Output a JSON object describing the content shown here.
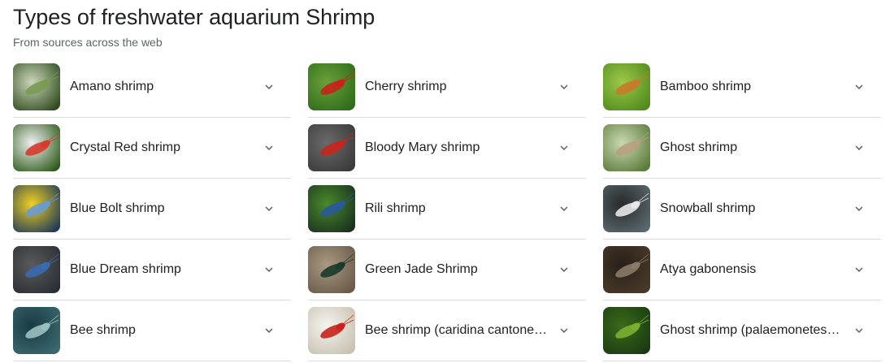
{
  "header": {
    "title": "Types of freshwater aquarium Shrimp",
    "subtitle": "From sources across the web"
  },
  "items": [
    {
      "label": "Amano shrimp",
      "icon": "chevron-down-icon",
      "thumb_colors": [
        "#2f4a1e",
        "#7a9a52",
        "#c9d6b8"
      ]
    },
    {
      "label": "Cherry shrimp",
      "icon": "chevron-down-icon",
      "thumb_colors": [
        "#2e6b1a",
        "#c8221a",
        "#6aa03a"
      ]
    },
    {
      "label": "Bamboo shrimp",
      "icon": "chevron-down-icon",
      "thumb_colors": [
        "#4f8a1c",
        "#c97a2a",
        "#9cc84a"
      ]
    },
    {
      "label": "Crystal Red shrimp",
      "icon": "chevron-down-icon",
      "thumb_colors": [
        "#2d5a1a",
        "#d63a2a",
        "#f0f0f0"
      ]
    },
    {
      "label": "Bloody Mary shrimp",
      "icon": "chevron-down-icon",
      "thumb_colors": [
        "#3a3a3a",
        "#c8261c",
        "#6a6a6a"
      ]
    },
    {
      "label": "Ghost shrimp",
      "icon": "chevron-down-icon",
      "thumb_colors": [
        "#5a7a3a",
        "#b8a080",
        "#c9d8b0"
      ]
    },
    {
      "label": "Blue Bolt shrimp",
      "icon": "chevron-down-icon",
      "thumb_colors": [
        "#1e3a5a",
        "#6a9ad0",
        "#f0d020"
      ]
    },
    {
      "label": "Rili shrimp",
      "icon": "chevron-down-icon",
      "thumb_colors": [
        "#1a3020",
        "#2a5a9a",
        "#4a8a2a"
      ]
    },
    {
      "label": "Snowball shrimp",
      "icon": "chevron-down-icon",
      "thumb_colors": [
        "#5a6a70",
        "#e8e8e8",
        "#2a2a2a"
      ]
    },
    {
      "label": "Blue Dream shrimp",
      "icon": "chevron-down-icon",
      "thumb_colors": [
        "#2a2e34",
        "#3a6ab0",
        "#5a5a5a"
      ]
    },
    {
      "label": "Green Jade Shrimp",
      "icon": "chevron-down-icon",
      "thumb_colors": [
        "#6a5a4a",
        "#1a3a2a",
        "#a89a80"
      ]
    },
    {
      "label": "Atya gabonensis",
      "icon": "chevron-down-icon",
      "thumb_colors": [
        "#4a3a2a",
        "#8a7a6a",
        "#2a2018"
      ]
    },
    {
      "label": "Bee shrimp",
      "icon": "chevron-down-icon",
      "thumb_colors": [
        "#3a6a70",
        "#9ac0c0",
        "#1a3a40"
      ]
    },
    {
      "label": "Bee shrimp (caridina cantone…",
      "icon": "chevron-down-icon",
      "thumb_colors": [
        "#c8c0b0",
        "#c8221a",
        "#f4f4f0"
      ]
    },
    {
      "label": "Ghost shrimp (palaemonetes …",
      "icon": "chevron-down-icon",
      "thumb_colors": [
        "#1a3a12",
        "#7ab030",
        "#3a6a1a"
      ]
    }
  ]
}
